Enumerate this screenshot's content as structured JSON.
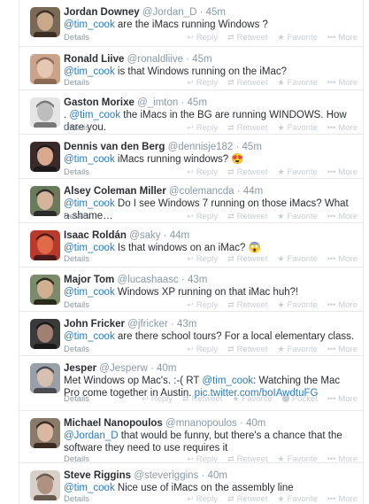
{
  "actions": {
    "details": "Details",
    "reply": "Reply",
    "retweet": "Retweet",
    "favorite": "Favorite",
    "pocket": "Pocket",
    "more": "More"
  },
  "icons": {
    "reply": "reply-arrow-icon",
    "retweet": "retweet-arrows-icon",
    "favorite": "star-icon",
    "pocket": "pocket-icon",
    "more": "ellipsis-icon"
  },
  "colors": {
    "link": "#2b7bb9",
    "muted": "#8899a6",
    "action": "#c6cfd6"
  },
  "tweets": [
    {
      "name": "Jordan Downey",
      "handle": "@Jordan_D",
      "time": "45m",
      "parts": [
        {
          "t": "@tim_cook",
          "c": "mention"
        },
        {
          "t": " are the iMacs running Windows ?"
        }
      ]
    },
    {
      "name": "Ronald Liive",
      "handle": "@ronaldliive",
      "time": "45m",
      "parts": [
        {
          "t": "@tim_cook",
          "c": "mention"
        },
        {
          "t": " is that Windows running on the iMac?"
        }
      ]
    },
    {
      "name": "Gaston Morixe",
      "handle": "@_imton",
      "time": "45m",
      "parts": [
        {
          "t": ". "
        },
        {
          "t": "@tim_cook",
          "c": "mention"
        },
        {
          "t": " the iMacs in the BG are running WINDOWS. How dare you."
        }
      ]
    },
    {
      "name": "Dennis van den Berg",
      "handle": "@dennisje182",
      "time": "45m",
      "parts": [
        {
          "t": "@tim_cook",
          "c": "mention"
        },
        {
          "t": " iMacs running windows? "
        },
        {
          "t": "😍",
          "c": "emoji"
        }
      ]
    },
    {
      "name": "Alsey Coleman Miller",
      "handle": "@colemancda",
      "time": "44m",
      "parts": [
        {
          "t": "@tim_cook",
          "c": "mention"
        },
        {
          "t": " Do I see Windows 7 running on those iMacs? What a shame…"
        }
      ]
    },
    {
      "name": "Isaac Roldán",
      "handle": "@saky",
      "time": "44m",
      "parts": [
        {
          "t": "@tim_cook",
          "c": "mention"
        },
        {
          "t": " Is that windows on an iMac? "
        },
        {
          "t": "😱",
          "c": "emoji"
        }
      ]
    },
    {
      "name": "Major Tom",
      "handle": "@lucashaasc",
      "time": "43m",
      "parts": [
        {
          "t": "@tim_cook",
          "c": "mention"
        },
        {
          "t": " Windows XP running on that iMac huh?!"
        }
      ]
    },
    {
      "name": "John Fricker",
      "handle": "@jfricker",
      "time": "43m",
      "parts": [
        {
          "t": "@tim_cook",
          "c": "mention"
        },
        {
          "t": " are there school tours? For a local elementary class."
        }
      ]
    },
    {
      "name": "Jesper",
      "handle": "@Jesperw",
      "time": "40m",
      "parts": [
        {
          "t": "Met Windows op Mac's. :-( RT "
        },
        {
          "t": "@tim_cook",
          "c": "mention"
        },
        {
          "t": ": Watching the Mac Pro come together in Austin. "
        },
        {
          "t": "pic.twitter.com/boIAwdtuFG",
          "c": "link"
        }
      ],
      "pocket": true
    },
    {
      "name": "Michael Nanopoulos",
      "handle": "@mnanopoulos",
      "time": "40m",
      "parts": [
        {
          "t": "@Jordan_D",
          "c": "mention"
        },
        {
          "t": " that would be funny, but there's a chance that the software they need to use requires it"
        }
      ]
    },
    {
      "name": "Steve Riggins",
      "handle": "@steveriggins",
      "time": "40m",
      "parts": [
        {
          "t": "@tim_cook",
          "c": "mention"
        },
        {
          "t": " Nice use of iMacs on the assembly line"
        }
      ]
    }
  ]
}
